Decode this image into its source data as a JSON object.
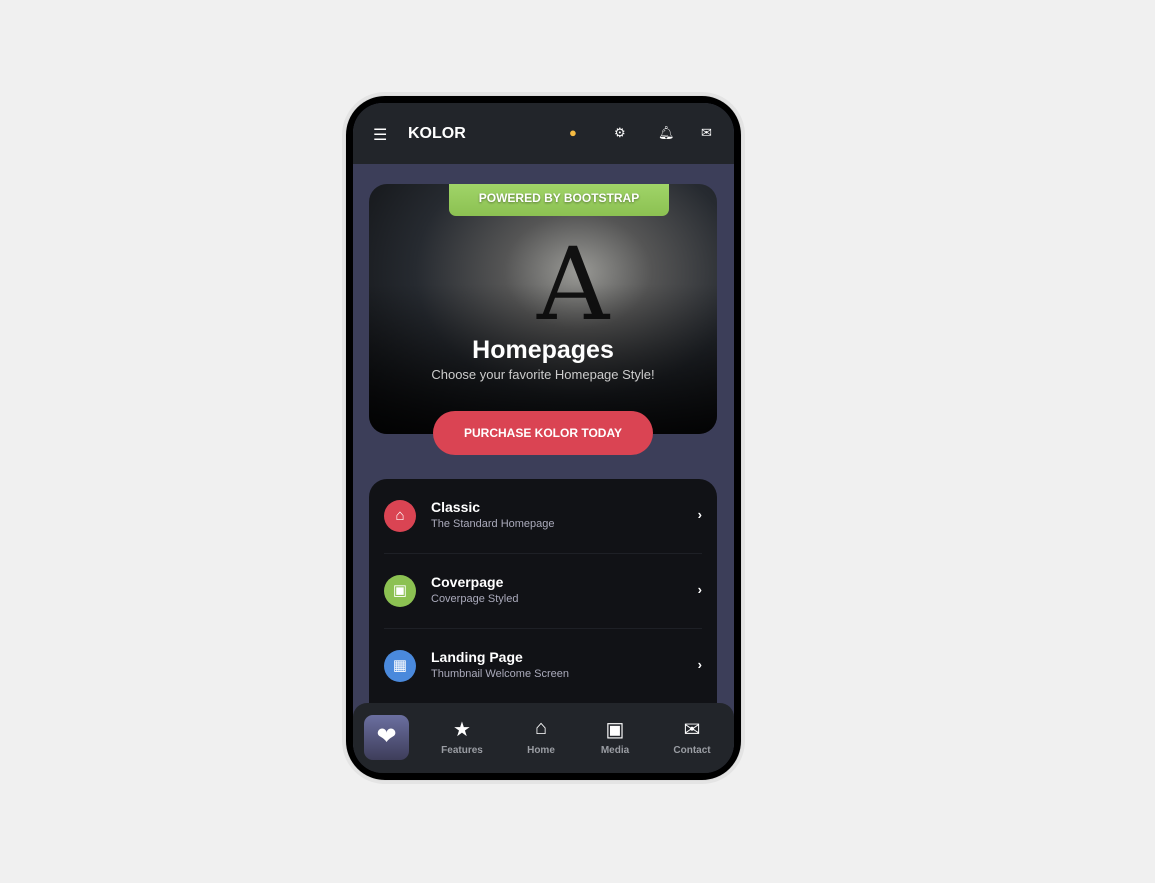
{
  "header": {
    "title": "KOLOR",
    "icons": [
      "menu-icon",
      "lightbulb-icon",
      "gear-icon",
      "bell-icon",
      "envelope-icon"
    ],
    "accent": "#f6bb42"
  },
  "hero": {
    "badge": "POWERED BY BOOTSTRAP",
    "title": "Homepages",
    "subtitle": "Choose your favorite Homepage Style!",
    "button": "PURCHASE KOLOR TODAY"
  },
  "list": [
    {
      "title": "Classic",
      "subtitle": "The Standard Homepage",
      "icon": "home-icon",
      "color": "#da4453"
    },
    {
      "title": "Coverpage",
      "subtitle": "Coverpage Styled",
      "icon": "image-icon",
      "color": "#8cc152"
    },
    {
      "title": "Landing Page",
      "subtitle": "Thumbnail Welcome Screen",
      "icon": "grid-icon",
      "color": "#4a89dc"
    }
  ],
  "nav": [
    {
      "label": "Features",
      "icon": "star-icon"
    },
    {
      "label": "Home",
      "icon": "home-icon"
    },
    {
      "label": "Media",
      "icon": "image-icon"
    },
    {
      "label": "Contact",
      "icon": "envelope-icon"
    }
  ]
}
